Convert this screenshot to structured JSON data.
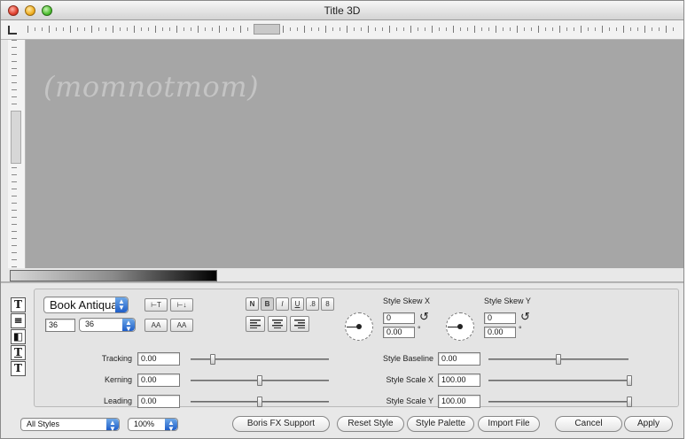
{
  "window": {
    "title": "Title 3D"
  },
  "canvas": {
    "text": "(momnotmom)"
  },
  "side_tabs": [
    {
      "glyph": "T",
      "icon": "text-tab-icon"
    },
    {
      "glyph": "≡",
      "icon": "paragraph-tab-icon"
    },
    {
      "glyph": "◧",
      "icon": "fill-tab-icon"
    },
    {
      "glyph": "T",
      "icon": "outline-tab-icon"
    },
    {
      "glyph": "T",
      "icon": "shadow-tab-icon"
    }
  ],
  "font": {
    "family": "Book Antiqua",
    "size_value": "36",
    "size_select": "36"
  },
  "baseline_buttons": [
    "⊢T",
    "⊢↓"
  ],
  "size_buttons": [
    "AA",
    "AA"
  ],
  "format_buttons": [
    "N",
    "B",
    "I",
    "U",
    ".8",
    "8"
  ],
  "align_buttons": [
    "left-align-icon",
    "center-align-icon",
    "right-align-icon"
  ],
  "skew_x": {
    "label": "Style Skew X",
    "value": "0",
    "value2": "0.00"
  },
  "skew_y": {
    "label": "Style Skew Y",
    "value": "0",
    "value2": "0.00"
  },
  "params_left": [
    {
      "label": "Tracking",
      "value": "0.00"
    },
    {
      "label": "Kerning",
      "value": "0.00"
    },
    {
      "label": "Leading",
      "value": "0.00"
    }
  ],
  "params_right": [
    {
      "label": "Style Baseline",
      "value": "0.00"
    },
    {
      "label": "Style Scale X",
      "value": "100.00"
    },
    {
      "label": "Style Scale Y",
      "value": "100.00"
    }
  ],
  "footer": {
    "styles_select": "All Styles",
    "zoom_select": "100%",
    "buttons": [
      "Boris FX Support",
      "Reset Style",
      "Style Palette",
      "Import File"
    ],
    "cancel": "Cancel",
    "apply": "Apply"
  },
  "colors": {
    "canvas_bg": "#a6a6a6",
    "panel_bg": "#e8e8e8",
    "stepper_blue": "#1e5ec8"
  }
}
